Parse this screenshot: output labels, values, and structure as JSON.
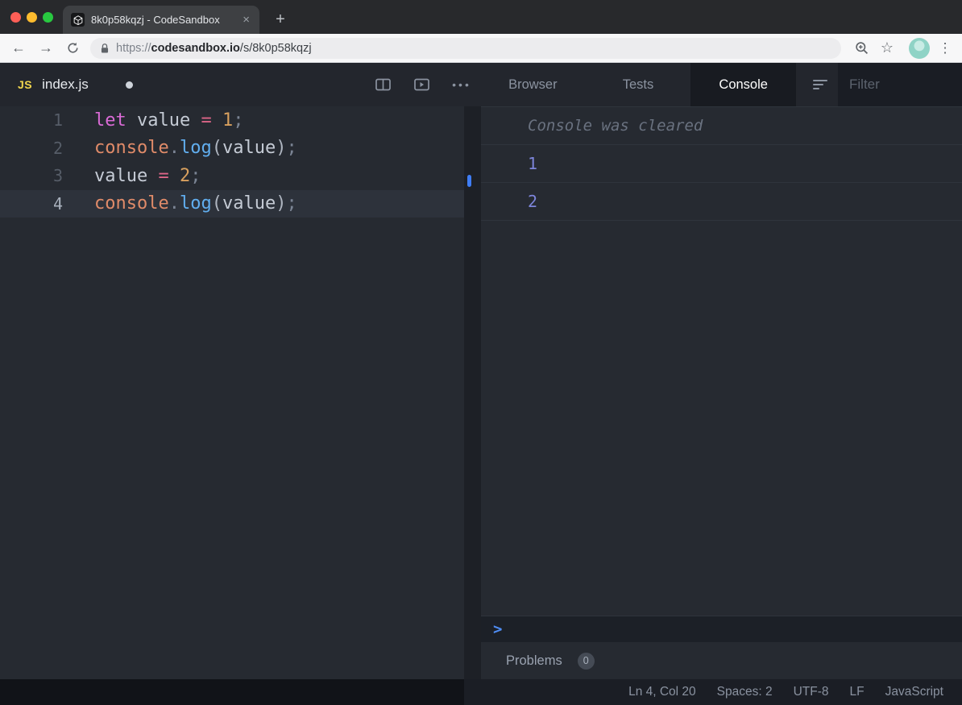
{
  "browser_chrome": {
    "tab_title": "8k0p58kqzj - CodeSandbox",
    "close_tab_glyph": "×",
    "new_tab_glyph": "+",
    "back_glyph": "←",
    "forward_glyph": "→",
    "star_glyph": "☆",
    "menu_glyph": "⋮",
    "url": {
      "scheme": "https://",
      "domain": "codesandbox.io",
      "path": "/s/8k0p58kqzj"
    }
  },
  "editor": {
    "file_icon_label": "JS",
    "file_name": "index.js",
    "more_glyph": "•••",
    "lines": [
      {
        "n": "1",
        "active": false,
        "tokens": [
          [
            "kw",
            "let"
          ],
          [
            "pl",
            " value "
          ],
          [
            "op",
            "="
          ],
          [
            "pl",
            " "
          ],
          [
            "num",
            "1"
          ],
          [
            "pu",
            ";"
          ]
        ]
      },
      {
        "n": "2",
        "active": false,
        "tokens": [
          [
            "obj",
            "console"
          ],
          [
            "pu",
            "."
          ],
          [
            "fn",
            "log"
          ],
          [
            "pr",
            "("
          ],
          [
            "pl",
            "value"
          ],
          [
            "pr",
            ")"
          ],
          [
            "pu",
            ";"
          ]
        ]
      },
      {
        "n": "3",
        "active": false,
        "tokens": [
          [
            "pl",
            "value "
          ],
          [
            "op",
            "="
          ],
          [
            "pl",
            " "
          ],
          [
            "num",
            "2"
          ],
          [
            "pu",
            ";"
          ]
        ]
      },
      {
        "n": "4",
        "active": true,
        "tokens": [
          [
            "obj",
            "console"
          ],
          [
            "pu",
            "."
          ],
          [
            "fn",
            "log"
          ],
          [
            "pr",
            "("
          ],
          [
            "pl",
            "value"
          ],
          [
            "pr",
            ")"
          ],
          [
            "pu",
            ";"
          ]
        ]
      }
    ]
  },
  "panel": {
    "tabs": [
      {
        "label": "Browser",
        "active": false
      },
      {
        "label": "Tests",
        "active": false
      },
      {
        "label": "Console",
        "active": true
      }
    ],
    "filter_placeholder": "Filter",
    "console_cleared_message": "Console was cleared",
    "entries": [
      "1",
      "2"
    ],
    "prompt_glyph": ">",
    "problems_label": "Problems",
    "problems_count": "0"
  },
  "status_bar": {
    "items": [
      "Ln 4, Col 20",
      "Spaces: 2",
      "UTF-8",
      "LF",
      "JavaScript"
    ]
  },
  "colors": {
    "accent_blue": "#3f7df4",
    "console_value": "#7d85da",
    "active_tab_bg": "#181b21"
  }
}
